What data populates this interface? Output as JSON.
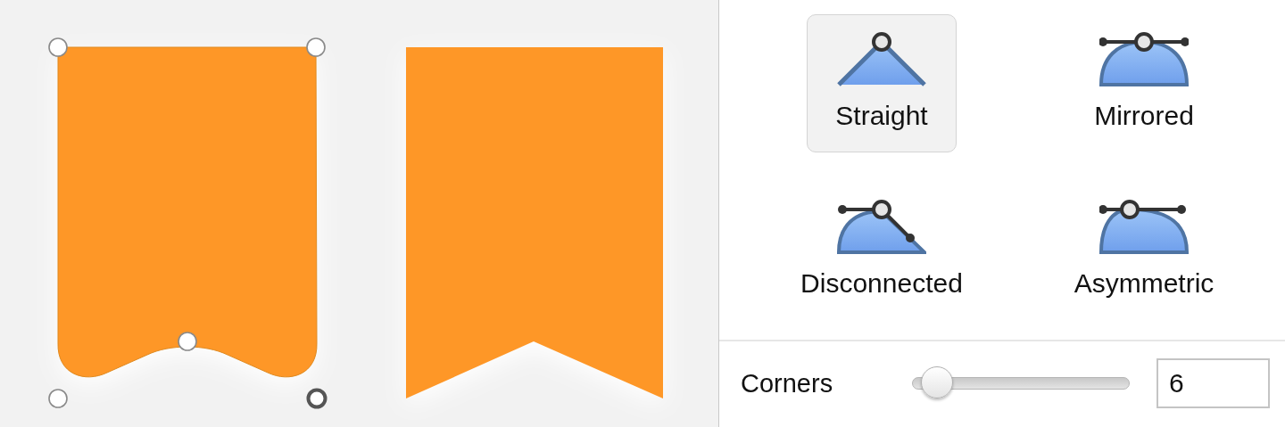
{
  "canvas": {
    "shapes": [
      {
        "kind": "wavy-banner",
        "handles": [
          {
            "selected": false
          },
          {
            "selected": false
          },
          {
            "selected": false
          },
          {
            "selected": false
          },
          {
            "selected": true
          }
        ]
      },
      {
        "kind": "notched-banner"
      }
    ]
  },
  "point_types": [
    {
      "kind": "straight",
      "label": "Straight",
      "selected": true
    },
    {
      "kind": "mirrored",
      "label": "Mirrored",
      "selected": false
    },
    {
      "kind": "disconnected",
      "label": "Disconnected",
      "selected": false
    },
    {
      "kind": "asymmetric",
      "label": "Asymmetric",
      "selected": false
    }
  ],
  "corners": {
    "label": "Corners",
    "level": 0.05,
    "value": "6"
  }
}
